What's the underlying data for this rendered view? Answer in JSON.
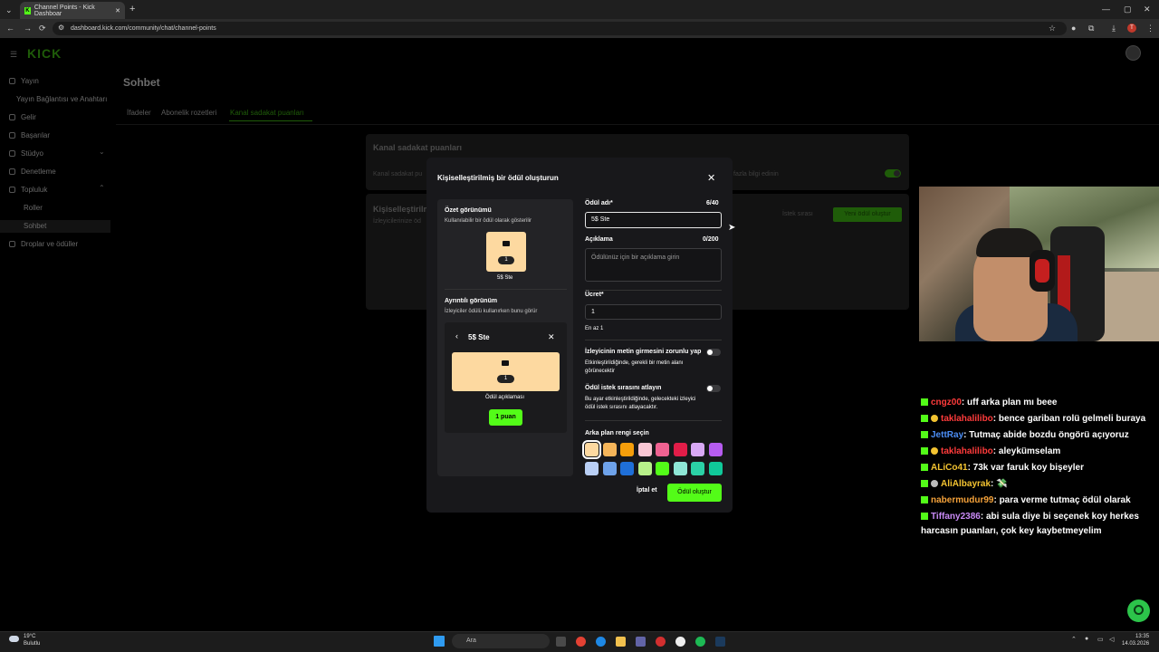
{
  "browser": {
    "tab_title": "Channel Points - Kick Dashboar",
    "url": "dashboard.kick.com/community/chat/channel-points"
  },
  "sidebar": {
    "logo": "KICK",
    "items": [
      {
        "label": "Yayın"
      },
      {
        "label": "Yayın Bağlantısı ve Anahtarı"
      },
      {
        "label": "Gelir"
      },
      {
        "label": "Başarılar"
      },
      {
        "label": "Stüdyo"
      },
      {
        "label": "Denetleme"
      },
      {
        "label": "Topluluk"
      },
      {
        "label": "Roller"
      },
      {
        "label": "Sohbet"
      },
      {
        "label": "Droplar ve ödüller"
      }
    ]
  },
  "page": {
    "title": "Sohbet",
    "tabs": [
      "İfadeler",
      "Abonelik rozetleri",
      "Kanal sadakat puanları"
    ],
    "card_title": "Kanal sadakat puanları",
    "card_text": "Kanal sadakat pu",
    "card_more": "fazla bilgi edinin",
    "rewards_title": "Kişiselleştirilm",
    "rewards_sub": "İzleyicilerinize öd",
    "queue_link": "İstek sırası",
    "new_reward": "Yeni ödül oluştur"
  },
  "modal": {
    "title": "Kişiselleştirilmiş bir ödül oluşturun",
    "summary_title": "Özet görünümü",
    "summary_sub": "Kullanılabilir bir ödül olarak gösterilir",
    "tile_cost": "1",
    "tile_name": "5$ Ste",
    "detail_title": "Ayrıntılı görünüm",
    "detail_sub": "İzleyiciler ödülü kullanırken bunu görür",
    "detail_header": "5$ Ste",
    "detail_cost": "1",
    "detail_desc": "Ödül açıklaması",
    "detail_button": "1 puan",
    "name_label": "Ödül adı*",
    "name_count": "6/40",
    "name_value": "5$ Ste",
    "desc_label": "Açıklama",
    "desc_count": "0/200",
    "desc_placeholder": "Ödülünüz için bir açıklama girin",
    "cost_label": "Ücret*",
    "cost_value": "1",
    "cost_hint": "En az 1",
    "toggle1_label": "İzleyicinin metin girmesini zorunlu yap",
    "toggle1_desc": "Etkinleştirildiğinde, gerekli bir metin alanı görünecektir",
    "toggle2_label": "Ödül istek sırasını atlayın",
    "toggle2_desc": "Bu ayar etkinleştirildiğinde, gelecekteki izleyici ödül istek sırasını atlayacaktır.",
    "bg_label": "Arka plan rengi seçin",
    "swatches_row1": [
      "#fdd9a0",
      "#f5b55a",
      "#f59e0b",
      "#f9c6d4",
      "#f06292",
      "#e11d48",
      "#d8a8f5",
      "#b65cf0"
    ],
    "swatches_row2": [
      "#b9cff5",
      "#6ea2ea",
      "#1f6fd8",
      "#b7f08a",
      "#53fc18",
      "#8ee6d6",
      "#2bd1a6",
      "#10c99a"
    ],
    "cancel": "İptal et",
    "create": "Ödül oluştur"
  },
  "chat": [
    {
      "user": "cngz00",
      "color": "#ff3b3b",
      "badges": [
        "kick"
      ],
      "text": ": uff arka plan mı beee"
    },
    {
      "user": "taklahalilibo",
      "color": "#ff3b3b",
      "badges": [
        "kick",
        "sub"
      ],
      "text": ": bence gariban rolü gelmeli buraya"
    },
    {
      "user": "JettRay",
      "color": "#4c8ef5",
      "badges": [
        "kick"
      ],
      "text": ": Tutmaç abide bozdu öngörü açıyoruz"
    },
    {
      "user": "taklahalilibo",
      "color": "#ff3b3b",
      "badges": [
        "kick",
        "sub"
      ],
      "text": ": aleykümselam"
    },
    {
      "user": "ALiCo41",
      "color": "#f3c331",
      "badges": [
        "kick"
      ],
      "text": ": 73k var faruk koy bişeyler"
    },
    {
      "user": "AliAlbayrak",
      "color": "#f3c331",
      "badges": [
        "kick",
        "other"
      ],
      "text": ": 💸"
    },
    {
      "user": "nabermudur99",
      "color": "#f5a23a",
      "badges": [
        "kick"
      ],
      "text": ": para verme tutmaç ödül olarak"
    },
    {
      "user": "Tiffany2386",
      "color": "#c98af5",
      "badges": [
        "kick"
      ],
      "text": ": abi sula diye bi seçenek koy herkes"
    },
    {
      "user": "",
      "color": "#fff",
      "badges": [],
      "text": "harcasın puanları, çok key kaybetmeyelim"
    }
  ],
  "taskbar": {
    "weather_temp": "19°C",
    "weather_desc": "Bulutlu",
    "search_placeholder": "Ara",
    "time": "13:35",
    "date": "14.03.2026"
  }
}
